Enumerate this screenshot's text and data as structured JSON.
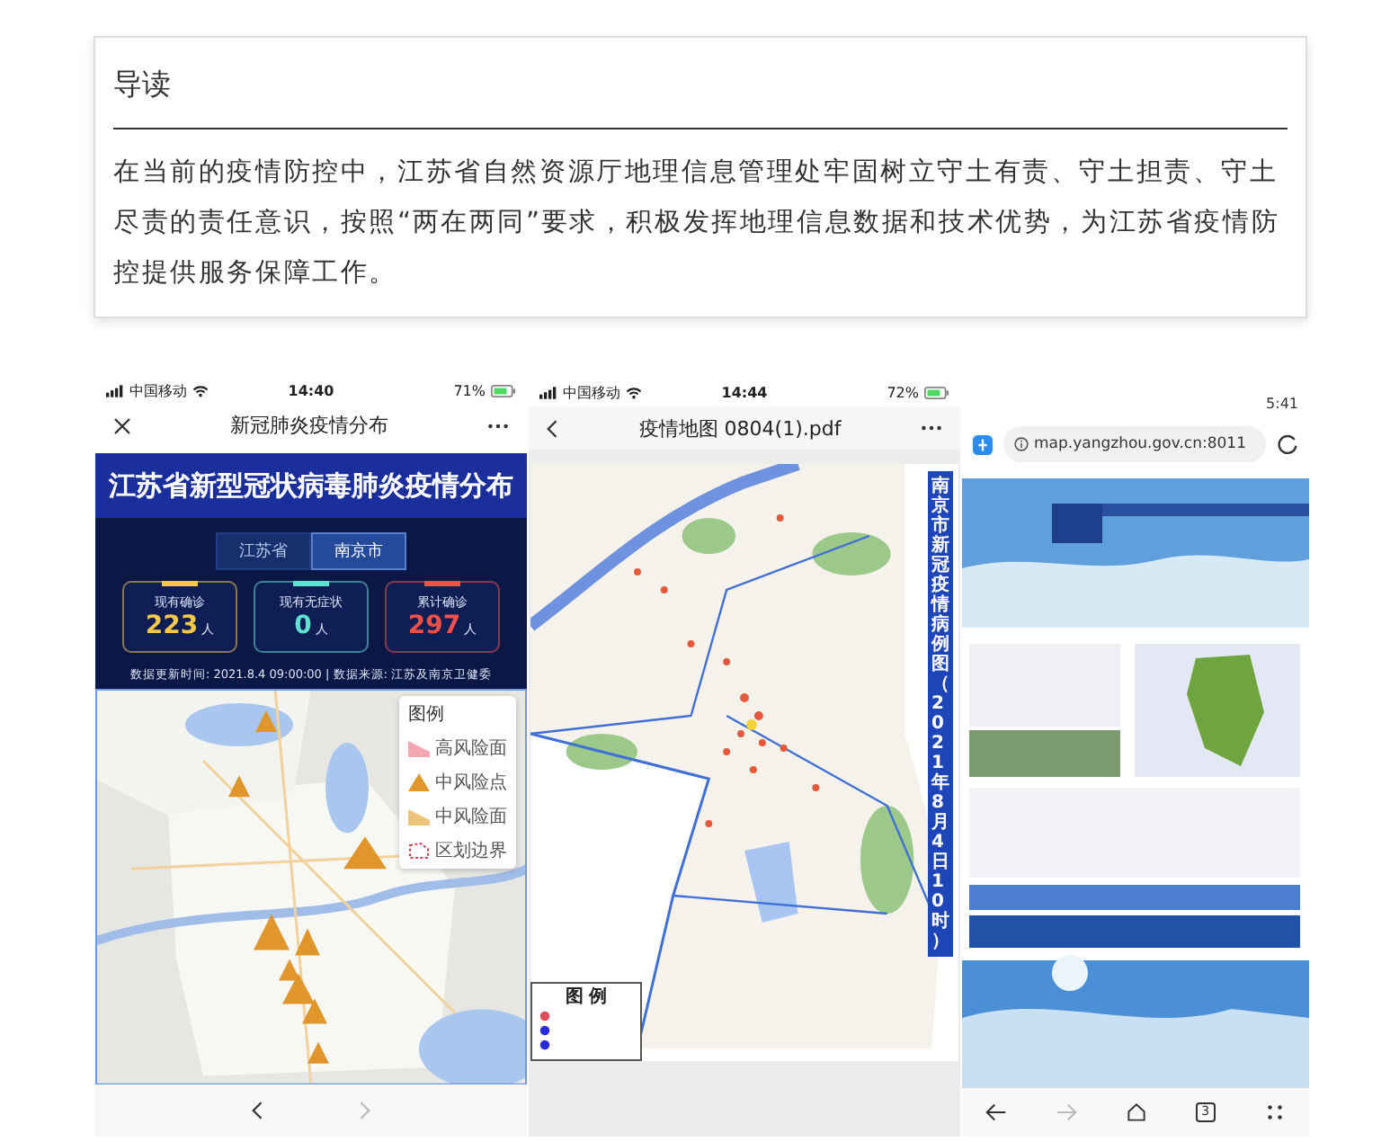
{
  "intro": {
    "title": "导读",
    "text": "在当前的疫情防控中，江苏省自然资源厅地理信息管理处牢固树立守土有责、守土担责、守土尽责的责任意识，按照“两在两同”要求，积极发挥地理信息数据和技术优势，为江苏省疫情防控提供服务保障工作。"
  },
  "screens": [
    {
      "kind": "epidemic_app",
      "status": {
        "carrier": "中国移动",
        "time": "14:40",
        "battery": "71%"
      },
      "title": "新冠肺炎疫情分布",
      "banner": "江苏省新型冠状病毒肺炎疫情分布",
      "tabs": [
        {
          "label": "江苏省",
          "selected": false
        },
        {
          "label": "南京市",
          "selected": true
        }
      ],
      "stats": [
        {
          "label": "现有确诊",
          "value": "223",
          "unit": "人",
          "color": "#f5c84a"
        },
        {
          "label": "现有无症状",
          "value": "0",
          "unit": "人",
          "color": "#5fe0d0"
        },
        {
          "label": "累计确诊",
          "value": "297",
          "unit": "人",
          "color": "#f0504a"
        }
      ],
      "update_line": "数据更新时间: 2021.8.4 09:00:00 | 数据来源: 江苏及南京卫健委",
      "legend": {
        "title": "图例",
        "items": [
          {
            "label": "高风险面",
            "kind": "area",
            "color": "#f2a7b2"
          },
          {
            "label": "中风险点",
            "kind": "point",
            "color": "#e0962a"
          },
          {
            "label": "中风险面",
            "kind": "area",
            "color": "#ecc47c"
          },
          {
            "label": "区划边界",
            "kind": "boundary",
            "color": "#d04050"
          }
        ]
      }
    },
    {
      "kind": "pdf_viewer",
      "status": {
        "carrier": "中国移动",
        "time": "14:44",
        "battery": "72%"
      },
      "title": "疫情地图 0804(1).pdf",
      "map_caption": "南京市新冠疫情病例图（2021年8月4日10时）",
      "legend": {
        "title": "图 例",
        "items": [
          {
            "color": "#e04a5a"
          },
          {
            "color": "#2a2ae0"
          },
          {
            "color": "#2a2ae0"
          }
        ]
      }
    },
    {
      "kind": "browser",
      "status": {
        "time": "5:41"
      },
      "url": "map.yangzhou.gov.cn:8011",
      "tab_count": "3"
    }
  ]
}
